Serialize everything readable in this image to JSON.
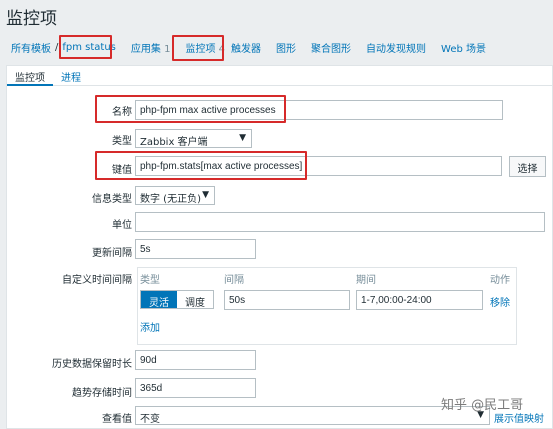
{
  "page": {
    "title": "监控项"
  },
  "breadcrumb": {
    "all_templates": "所有模板",
    "separator": "/",
    "host": "fpm status",
    "applications": "应用集",
    "applications_count": "1",
    "items": "监控项",
    "items_count": "4",
    "triggers": "触发器",
    "graphs": "图形",
    "screens": "聚合图形",
    "discovery": "自动发现规则",
    "web": "Web 场景"
  },
  "tabs": [
    "监控项",
    "进程"
  ],
  "form": {
    "name_label": "名称",
    "name_value": "php-fpm max active processes",
    "type_label": "类型",
    "type_value": "Zabbix 客户端",
    "key_label": "键值",
    "key_value": "php-fpm.stats[max active processes]",
    "select_button": "选择",
    "info_type_label": "信息类型",
    "info_type_value": "数字 (无正负)",
    "units_label": "单位",
    "units_value": "",
    "interval_label": "更新间隔",
    "interval_value": "5s",
    "custom_intervals_label": "自定义时间间隔",
    "history_label": "历史数据保留时长",
    "history_value": "90d",
    "trends_label": "趋势存储时间",
    "trends_value": "365d",
    "show_value_label": "查看值",
    "show_value_value": "不变",
    "show_value_link": "展示值映射"
  },
  "schedule": {
    "col_type": "类型",
    "col_interval": "间隔",
    "col_period": "期间",
    "col_action": "动作",
    "flexible": "灵活",
    "scheduling": "调度",
    "interval_value": "50s",
    "period_value": "1-7,00:00-24:00",
    "remove": "移除",
    "add": "添加"
  },
  "watermark": "知乎 @民工哥",
  "colors": {
    "accent": "#0275b8",
    "highlight_box": "#d62a2a",
    "background": "#ebeef0"
  }
}
